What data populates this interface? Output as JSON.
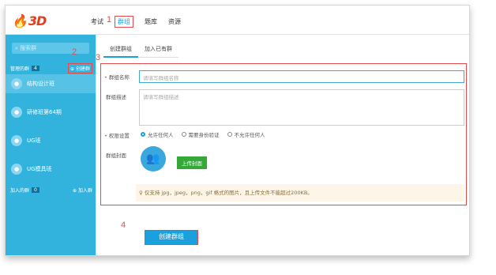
{
  "logo": {
    "text": "3D"
  },
  "topnav": {
    "items": [
      "考试",
      "群组",
      "题库",
      "资源"
    ],
    "active": "群组"
  },
  "markers": {
    "m1": "1",
    "m2": "2",
    "m3": "3",
    "m4": "4"
  },
  "sidebar": {
    "search_placeholder": "搜索群",
    "managed": {
      "label": "管理的群",
      "count": "4",
      "create": "创建群"
    },
    "items": [
      {
        "label": "结构设计班"
      },
      {
        "label": "研修班第64期"
      },
      {
        "label": "UG班"
      },
      {
        "label": "UG模具班"
      }
    ],
    "joined": {
      "label": "加入的群",
      "count": "0",
      "join": "加入群"
    }
  },
  "subtabs": [
    "创建群组",
    "加入已有群"
  ],
  "form": {
    "name_label": "群组名称",
    "name_placeholder": "请填写群组名称",
    "desc_label": "群组描述",
    "desc_placeholder": "请填写群组描述",
    "perm_label": "权限设置",
    "perm_options": [
      "允许任何人",
      "需要身份验证",
      "不允许任何人"
    ],
    "cover_label": "群组封面",
    "upload_label": "上传封面",
    "hint": "仅支持 jpg，jpeg，png，gif 格式的图片，且上传文件不能超过200KB。"
  },
  "submit_label": "创建群组",
  "colors": {
    "accent": "#1aa0dc",
    "sidebar": "#32b3de",
    "highlight": "#e54b4b",
    "upload": "#35a83a"
  }
}
